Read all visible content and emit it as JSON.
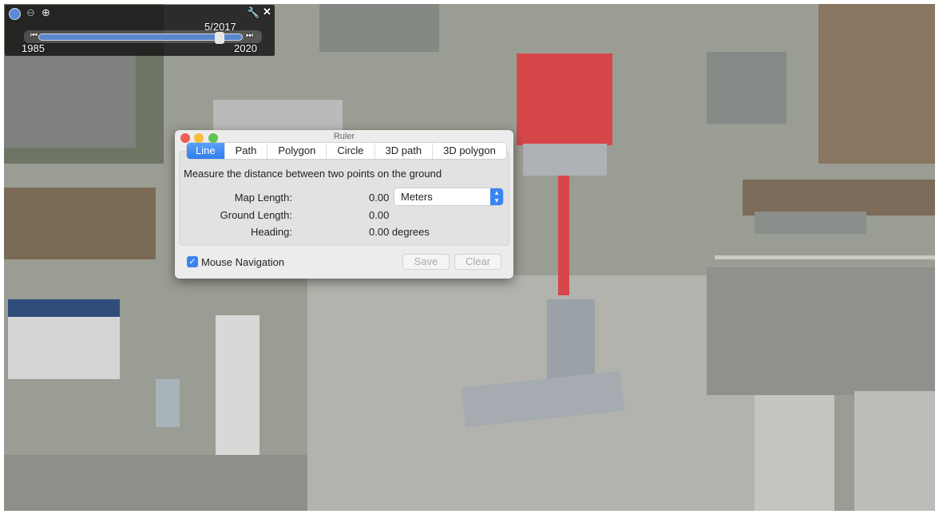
{
  "timeline": {
    "current": "5/2017",
    "start": "1985",
    "end": "2020",
    "position": 0.86
  },
  "ruler": {
    "title": "Ruler",
    "tabs": [
      "Line",
      "Path",
      "Polygon",
      "Circle",
      "3D path",
      "3D polygon"
    ],
    "active_tab": "Line",
    "description": "Measure the distance between two points on the ground",
    "map_length_label": "Map Length:",
    "map_length": "0.00",
    "unit": "Meters",
    "ground_length_label": "Ground Length:",
    "ground_length": "0.00",
    "heading_label": "Heading:",
    "heading": "0.00 degrees",
    "mouse_nav_label": "Mouse Navigation",
    "mouse_nav_checked": true,
    "save": "Save",
    "clear": "Clear"
  },
  "colors": {
    "accent": "#2f7ef0",
    "roof": "#d6474a"
  }
}
